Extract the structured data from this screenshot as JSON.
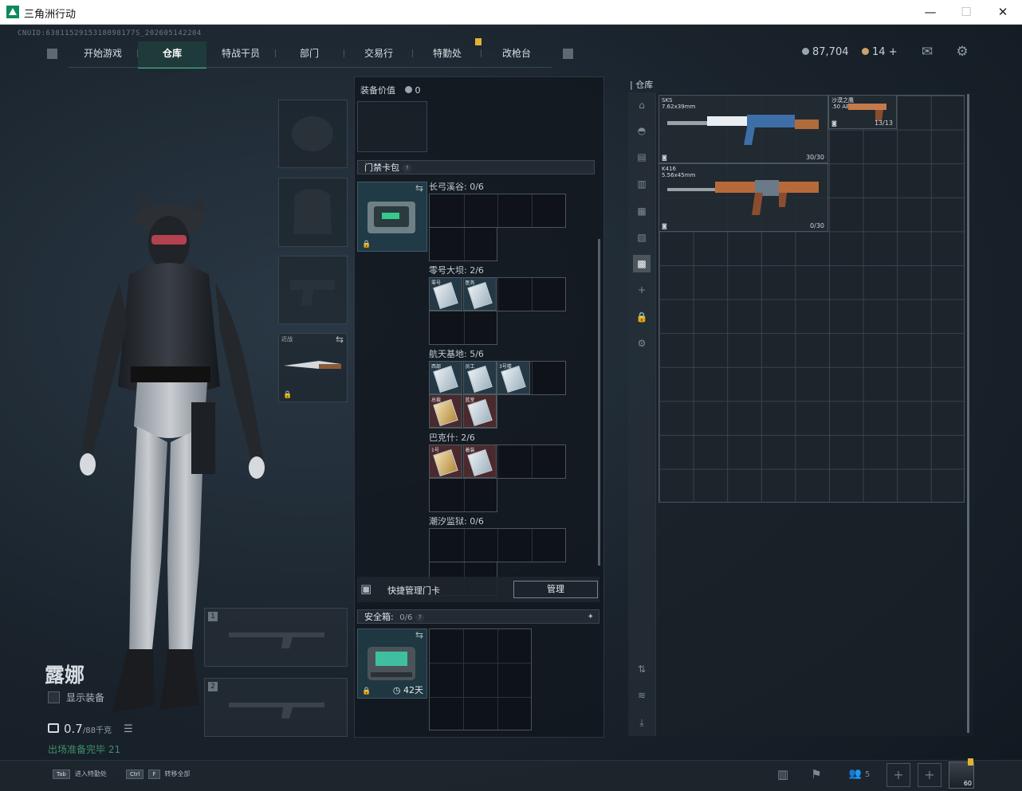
{
  "window": {
    "title": "三角洲行动",
    "minimize": "—",
    "maximize": "☐",
    "close": "✕"
  },
  "uid": "CNUID:6381152915318098177S_202605142204",
  "nav": {
    "tabs": [
      "开始游戏",
      "仓库",
      "特战干员",
      "部门",
      "交易行",
      "特勤处",
      "改枪台"
    ],
    "active": "仓库"
  },
  "currency": {
    "coins": "87,704",
    "tickets": "14",
    "plus": "+"
  },
  "character": {
    "name": "露娜",
    "show_equipment": "显示装备",
    "weight": "0.7",
    "weight_max": "/88千克",
    "hint": "出场准备完毕 21"
  },
  "equipment_slots": {
    "melee_label": "近战"
  },
  "center": {
    "gear_value_label": "装备价值",
    "gear_value": "0",
    "keycard_pack_title": "门禁卡包",
    "maps": [
      {
        "name": "长弓溪谷: 0/6",
        "cards": []
      },
      {
        "name": "零号大坝: 2/6",
        "cards": [
          {
            "label": "零号",
            "tone": "blue"
          },
          {
            "label": "医务",
            "tone": "blue"
          }
        ]
      },
      {
        "name": "航天基地: 5/6",
        "cards": [
          {
            "label": "西部",
            "tone": "blue"
          },
          {
            "label": "员工",
            "tone": "blue"
          },
          {
            "label": "3号楼",
            "tone": "blue"
          },
          {
            "label": "总裁",
            "tone": "red",
            "gold": true
          },
          {
            "label": "蓝室",
            "tone": "red"
          }
        ]
      },
      {
        "name": "巴克什: 2/6",
        "cards": [
          {
            "label": "1号",
            "tone": "red",
            "gold": true
          },
          {
            "label": "着装",
            "tone": "red"
          }
        ]
      },
      {
        "name": "潮汐监狱: 0/6",
        "cards": []
      }
    ],
    "quick_manage_label": "快捷管理门卡",
    "manage_button": "管理",
    "safe_box_label": "安全箱:",
    "safe_box_count": "0/6",
    "safe_box_days": "42天"
  },
  "warehouse": {
    "title": "仓库",
    "items": [
      {
        "name": "SKS",
        "caliber": "7.62x39mm",
        "count": "30/30"
      },
      {
        "name": "沙漠之鹰",
        "caliber": ".50 AE",
        "count": "13/13"
      },
      {
        "name": "K416",
        "caliber": "5.56x45mm",
        "count": "0/30"
      }
    ]
  },
  "bottom": {
    "hint1_key": "Tab",
    "hint1": "进入特勤处",
    "hint2_key1": "Ctrl",
    "hint2_key2": "F",
    "hint2": "转移全部",
    "friends_count": "5",
    "level": "60"
  },
  "colors": {
    "accent": "#31c48d",
    "notify": "#e1b233",
    "rare_red": "#4a2a2e",
    "rare_blue": "#243845"
  }
}
